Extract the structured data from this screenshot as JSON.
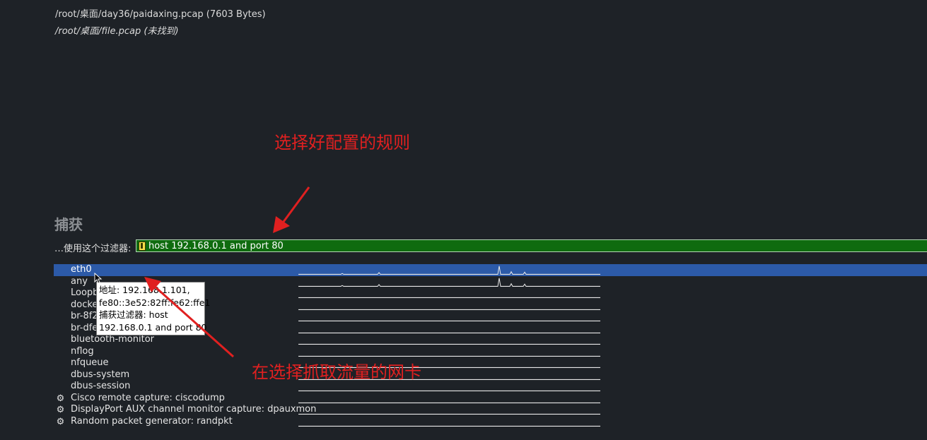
{
  "recent_files": [
    {
      "text": "/root/桌面/day36/paidaxing.pcap (7603 Bytes)",
      "missing": false
    },
    {
      "text": "/root/桌面/file.pcap (未找到)",
      "missing": true
    }
  ],
  "capture": {
    "section_title": "捕获",
    "filter_label": "…使用这个过滤器:",
    "filter_value": "host 192.168.0.1 and port 80",
    "filter_bar_color": "#0f6b0f",
    "interfaces": [
      {
        "name": "eth0",
        "selected": true,
        "gear": false,
        "activity": [
          0.1,
          0.2,
          0.95,
          0.3,
          0.25
        ]
      },
      {
        "name": "any",
        "selected": false,
        "gear": false,
        "activity": [
          0.1,
          0.2,
          0.95,
          0.3,
          0.25
        ]
      },
      {
        "name": "Loopback: lo",
        "selected": false,
        "gear": false,
        "activity": []
      },
      {
        "name": "docker0",
        "selected": false,
        "gear": false,
        "activity": []
      },
      {
        "name": "br-8f2",
        "selected": false,
        "gear": false,
        "activity": []
      },
      {
        "name": "br-dfe",
        "selected": false,
        "gear": false,
        "activity": []
      },
      {
        "name": "bluetooth-monitor",
        "selected": false,
        "gear": false,
        "activity": []
      },
      {
        "name": "nflog",
        "selected": false,
        "gear": false,
        "activity": []
      },
      {
        "name": "nfqueue",
        "selected": false,
        "gear": false,
        "activity": []
      },
      {
        "name": "dbus-system",
        "selected": false,
        "gear": false,
        "activity": []
      },
      {
        "name": "dbus-session",
        "selected": false,
        "gear": false,
        "activity": []
      },
      {
        "name": "Cisco remote capture: ciscodump",
        "selected": false,
        "gear": true,
        "activity": []
      },
      {
        "name": "DisplayPort AUX channel monitor capture: dpauxmon",
        "selected": false,
        "gear": true,
        "activity": []
      },
      {
        "name": "Random packet generator: randpkt",
        "selected": false,
        "gear": true,
        "activity": []
      }
    ],
    "tooltip": [
      "地址: 192.168.1.101,",
      "fe80::3e52:82ff:fe62:ffe1",
      "捕获过滤器: host",
      "192.168.0.1 and port 80"
    ]
  },
  "annotations": {
    "top": "选择好配置的规则",
    "bottom": "在选择抓取流量的网卡",
    "color": "#e02020"
  },
  "icons": {
    "gear": "settings-gear-icon",
    "bookmark": "filter-bookmark-icon"
  }
}
